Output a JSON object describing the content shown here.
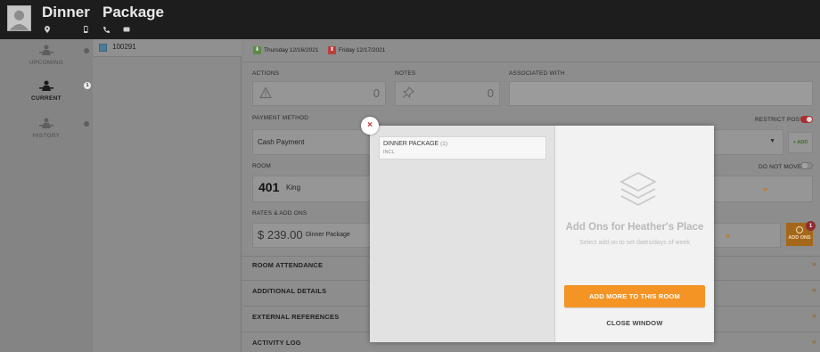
{
  "header": {
    "first_name": "Dinner",
    "last_name": "Package",
    "icons": [
      "location-pin-icon",
      "mobile-phone-icon",
      "phone-icon",
      "message-icon"
    ]
  },
  "nav": {
    "items": [
      {
        "label": "UPCOMING",
        "icon": "person-desk-icon",
        "badge": ""
      },
      {
        "label": "CURRENT",
        "icon": "person-desk-icon",
        "badge": "1"
      },
      {
        "label": "HISTORY",
        "icon": "person-desk-icon",
        "badge": ""
      }
    ]
  },
  "booking": {
    "id": "100291"
  },
  "dates": {
    "arrival": "Thursday 12/16/2021",
    "departure": "Friday 12/17/2021"
  },
  "sections": {
    "actions": {
      "label": "ACTIONS",
      "count": "0"
    },
    "notes": {
      "label": "NOTES",
      "count": "0"
    },
    "associated": {
      "label": "ASSOCIATED WITH"
    },
    "payment": {
      "label": "PAYMENT METHOD",
      "value": "Cash Payment",
      "restrict_label": "RESTRICT POST",
      "add_label": "+ ADD"
    },
    "room": {
      "label": "ROOM",
      "number": "401",
      "type": "King",
      "do_not_move_label": "DO NOT MOVE"
    },
    "rates": {
      "label": "RATES & ADD ONS",
      "amount": "$ 239.00",
      "package": "Dinner Package",
      "addons_button": "ADD ONS",
      "addons_badge": "1"
    },
    "collapsed": [
      "ROOM ATTENDANCE",
      "ADDITIONAL DETAILS",
      "EXTERNAL REFERENCES",
      "ACTIVITY LOG"
    ]
  },
  "modal": {
    "package_name": "DINNER PACKAGE",
    "package_qty": "(1)",
    "package_sub": "INCL",
    "title": "Add Ons for Heather's Place",
    "subtitle": "Select add on to set dates/days of week",
    "add_more": "ADD MORE TO THIS ROOM",
    "close": "CLOSE WINDOW",
    "close_x": "×"
  },
  "colors": {
    "accent_orange": "#f39425",
    "header_bg": "#1d1d1d",
    "close_red": "#c9302c"
  }
}
